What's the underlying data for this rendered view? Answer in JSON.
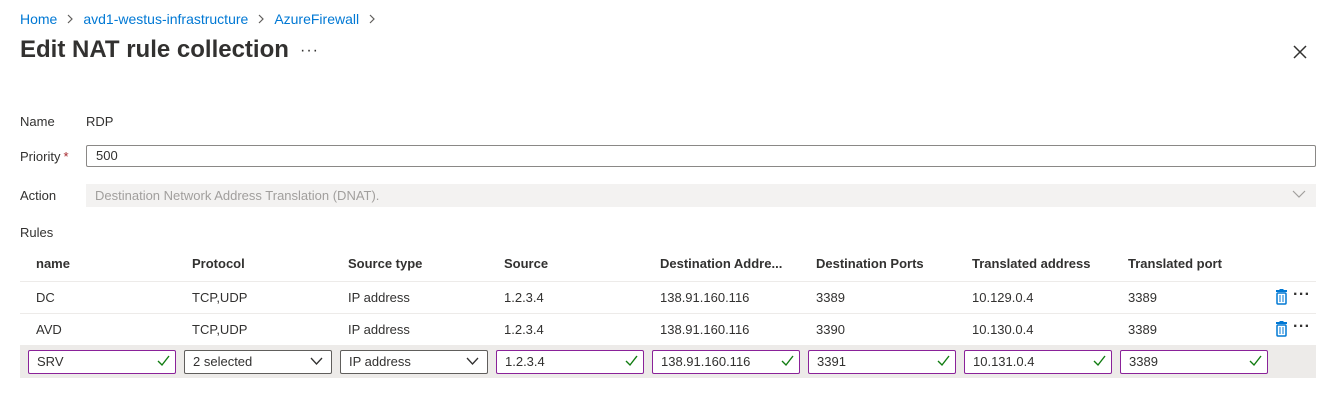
{
  "breadcrumb": {
    "items": [
      "Home",
      "avd1-westus-infrastructure",
      "AzureFirewall"
    ]
  },
  "page": {
    "title": "Edit NAT rule collection",
    "more": "···"
  },
  "form": {
    "name_label": "Name",
    "name_value": "RDP",
    "priority_label": "Priority",
    "required_mark": "*",
    "priority_value": "500",
    "action_label": "Action",
    "action_value": "Destination Network Address Translation (DNAT).",
    "rules_label": "Rules"
  },
  "rules": {
    "columns": [
      "name",
      "Protocol",
      "Source type",
      "Source",
      "Destination Addre...",
      "Destination Ports",
      "Translated address",
      "Translated port"
    ],
    "rows": [
      [
        "DC",
        "TCP,UDP",
        "IP address",
        "1.2.3.4",
        "138.91.160.116",
        "3389",
        "10.129.0.4",
        "3389"
      ],
      [
        "AVD",
        "TCP,UDP",
        "IP address",
        "1.2.3.4",
        "138.91.160.116",
        "3390",
        "10.130.0.4",
        "3389"
      ]
    ],
    "edit_row": [
      "SRV",
      "2 selected",
      "IP address",
      "1.2.3.4",
      "138.91.160.116",
      "3391",
      "10.131.0.4",
      "3389"
    ],
    "row_more": "···"
  },
  "colors": {
    "link": "#0078d4",
    "valid_border": "#8a2299",
    "check": "#107c10",
    "trash": "#0078d4"
  }
}
